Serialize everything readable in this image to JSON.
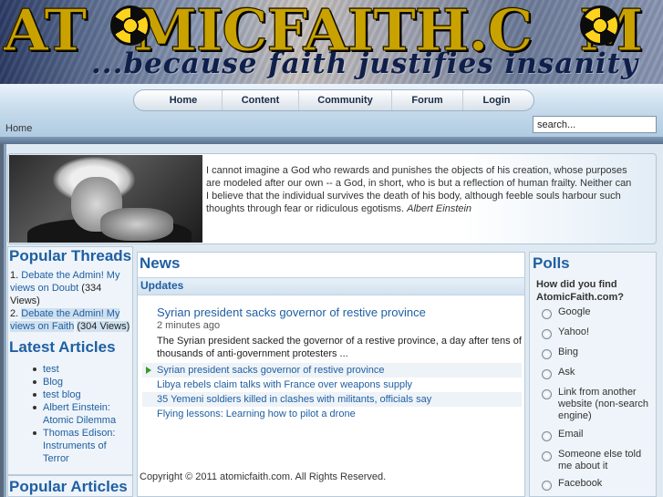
{
  "header": {
    "site_title": "AT  MICFAITH.C  M",
    "tagline": "...because faith justifies insanity"
  },
  "nav": {
    "items": [
      "Home",
      "Content",
      "Community",
      "Forum",
      "Login"
    ]
  },
  "breadcrumb": "Home",
  "search": {
    "value": "search..."
  },
  "quote": {
    "text": "I cannot imagine a God who rewards and punishes the objects of his creation, whose purposes are modeled after our own -- a God, in short, who is but a reflection of human frailty. Neither can I believe that the individual survives the death of his body, although feeble souls harbour such thoughts through fear or ridiculous egotisms.",
    "author": "Albert Einstein"
  },
  "popular_threads": {
    "title": "Popular Threads",
    "items": [
      {
        "num": "1.",
        "link": "Debate the Admin! My views on Doubt",
        "count": "(334 Views)"
      },
      {
        "num": "2.",
        "link": "Debate the Admin! My views on Faith",
        "count": "(304 Views)"
      }
    ]
  },
  "latest_articles": {
    "title": "Latest Articles",
    "items": [
      "test",
      "Blog",
      "test blog",
      "Albert Einstein: Atomic Dilemma",
      "Thomas Edison: Instruments of Terror"
    ]
  },
  "popular_articles": {
    "title": "Popular Articles"
  },
  "news": {
    "title": "News",
    "section": "Updates",
    "featured": {
      "headline": "Syrian president sacks governor of restive province",
      "time": "2 minutes ago",
      "summary": "The Syrian president sacked the governor of a restive province, a day after tens of thousands of anti-government protesters ..."
    },
    "headlines": [
      "Syrian president sacks governor of restive province",
      "Libya rebels claim talks with France over weapons supply",
      "35 Yemeni soldiers killed in clashes with militants, officials say",
      "Flying lessons: Learning how to pilot a drone"
    ],
    "copyright": "Copyright © 2011 atomicfaith.com. All Rights Reserved."
  },
  "polls": {
    "title": "Polls",
    "question": "How did you find AtomicFaith.com?",
    "options": [
      "Google",
      "Yahoo!",
      "Bing",
      "Ask",
      "Link from another website (non-search engine)",
      "Email",
      "Someone else told me about it",
      "Facebook"
    ]
  },
  "colors": {
    "link_blue": "#1f5fa2",
    "title_gold": "#c9a200",
    "tagline_navy": "#0f1f4a",
    "nav_band": "#c8dced"
  },
  "icons": [
    "radiation-icon",
    "arrow-right-icon",
    "radio-icon"
  ]
}
